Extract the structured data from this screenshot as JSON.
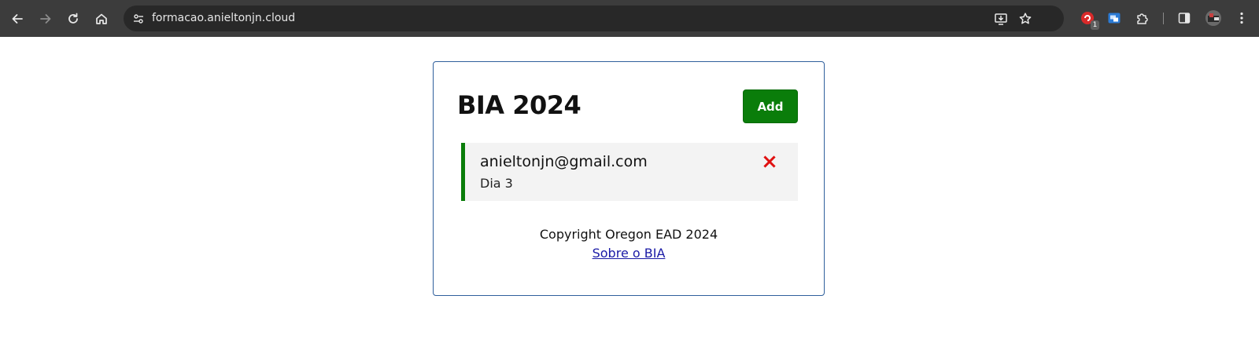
{
  "browser": {
    "url": "formacao.anieltonjn.cloud",
    "extension_badge": "1",
    "icons": {
      "back": "arrow-left-icon",
      "forward": "arrow-right-icon",
      "reload": "reload-icon",
      "home": "home-icon",
      "site_info": "tune-icon",
      "install": "install-app-icon",
      "bookmark": "star-icon",
      "extension": "extension-puzzle-icon",
      "side_panel": "side-panel-icon",
      "menu": "kebab-menu-icon"
    }
  },
  "app": {
    "title": "BIA 2024",
    "add_label": "Add",
    "tasks": [
      {
        "email": "anieltonjn@gmail.com",
        "day": "Dia 3",
        "delete_icon": "close-x-icon"
      }
    ],
    "footer": {
      "copyright": "Copyright Oregon EAD 2024",
      "about_link": "Sobre o BIA"
    }
  },
  "colors": {
    "browser_bar": "#3c3c3c",
    "omnibox": "#282828",
    "card_border": "#2f5f9c",
    "accent_green": "#0a7d0a",
    "delete_red": "#e01010",
    "link_blue": "#1a1aa6",
    "task_bg": "#f3f3f3"
  }
}
